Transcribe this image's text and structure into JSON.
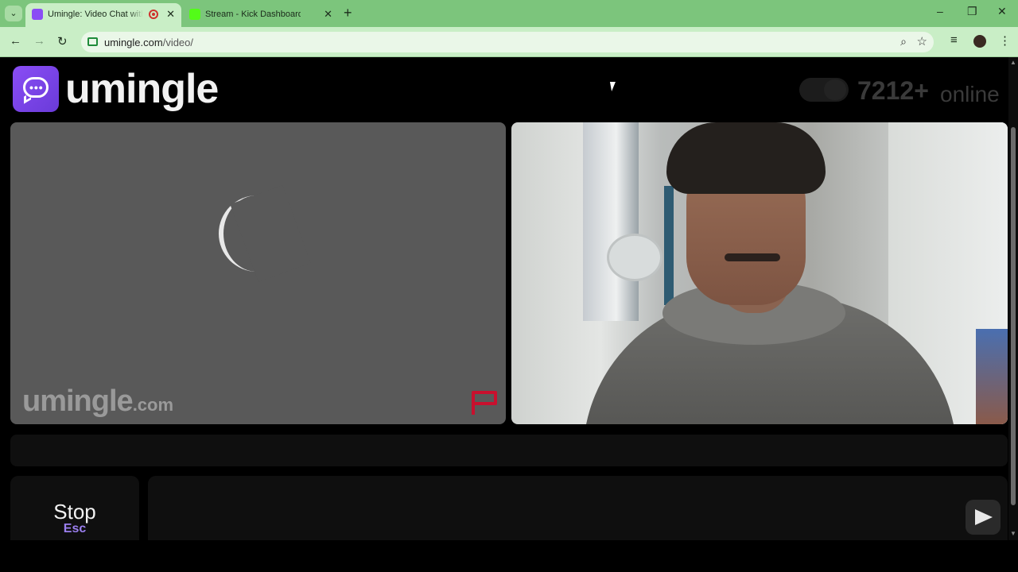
{
  "browser": {
    "tabs": [
      {
        "title": "Umingle: Video Chat with Strangers",
        "active": true,
        "recording": true
      },
      {
        "title": "Stream - Kick Dashboard",
        "active": false
      }
    ],
    "address": {
      "host": "umingle.com",
      "path": "/video/"
    },
    "icons": [
      "chevron-down-icon",
      "close-icon",
      "plus-icon",
      "back-icon",
      "forward-icon",
      "reload-icon",
      "zoom-icon",
      "star-icon",
      "media-icon",
      "profile-icon",
      "menu-icon"
    ]
  },
  "header": {
    "brand": "umingle",
    "online_count": "7212+",
    "online_label": "online"
  },
  "video": {
    "watermark_name": "umingle",
    "watermark_tld": ".com"
  },
  "controls": {
    "stop_label": "Stop",
    "stop_key": "Esc"
  },
  "colors": {
    "accent": "#8a4df5",
    "tab_bar": "#7cc57c",
    "report_flag": "#c8102e"
  }
}
